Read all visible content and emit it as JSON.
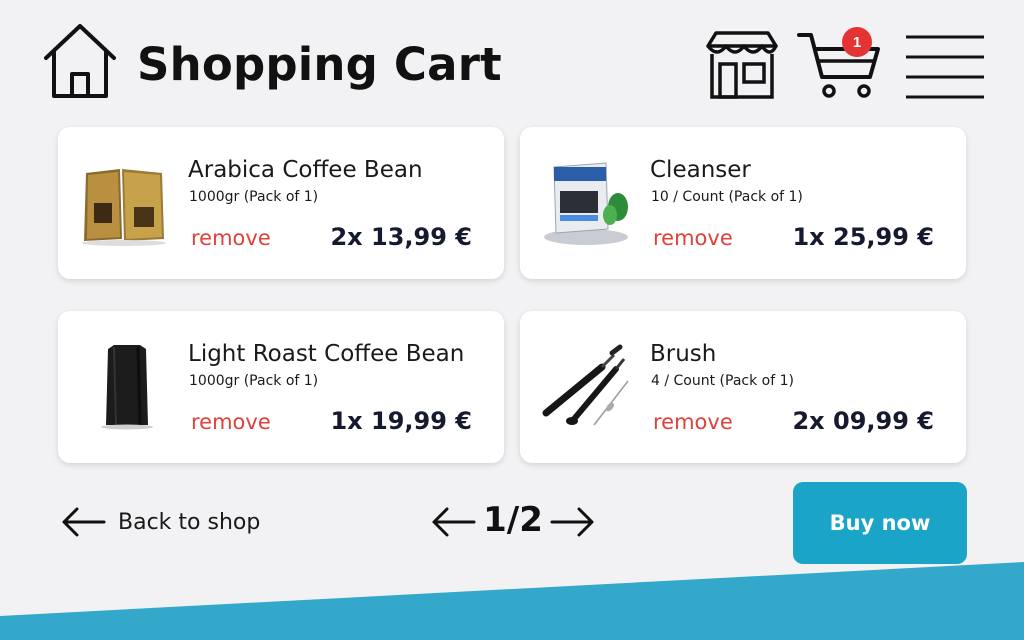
{
  "header": {
    "title": "Shopping Cart",
    "home_icon": "home-icon",
    "shop_icon": "storefront-icon",
    "cart_icon": "cart-icon",
    "cart_count": "1",
    "menu_icon": "menu-icon"
  },
  "cart": {
    "items": [
      {
        "name": "Arabica Coffee Bean",
        "detail": "1000gr (Pack of 1)",
        "remove_label": "remove",
        "price": "2x 13,99 €",
        "thumb": "gold-coffee-bags"
      },
      {
        "name": "Cleanser",
        "detail": "10 / Count (Pack of 1)",
        "remove_label": "remove",
        "price": "1x 25,99 €",
        "thumb": "cleanser-box"
      },
      {
        "name": "Light Roast Coffee Bean",
        "detail": "1000gr (Pack of 1)",
        "remove_label": "remove",
        "price": "1x 19,99 €",
        "thumb": "black-coffee-bag"
      },
      {
        "name": "Brush",
        "detail": "4 / Count (Pack of 1)",
        "remove_label": "remove",
        "price": "2x 09,99 €",
        "thumb": "cleaning-brushes"
      }
    ]
  },
  "footer": {
    "back_label": "Back to shop",
    "page_indicator": "1/2",
    "buy_label": "Buy now"
  },
  "colors": {
    "background": "#f2f2f4",
    "accent": "#1aa4c8",
    "remove": "#e0413a",
    "badge": "#e53333",
    "price": "#161a2e",
    "wave": "#34a8cb"
  }
}
